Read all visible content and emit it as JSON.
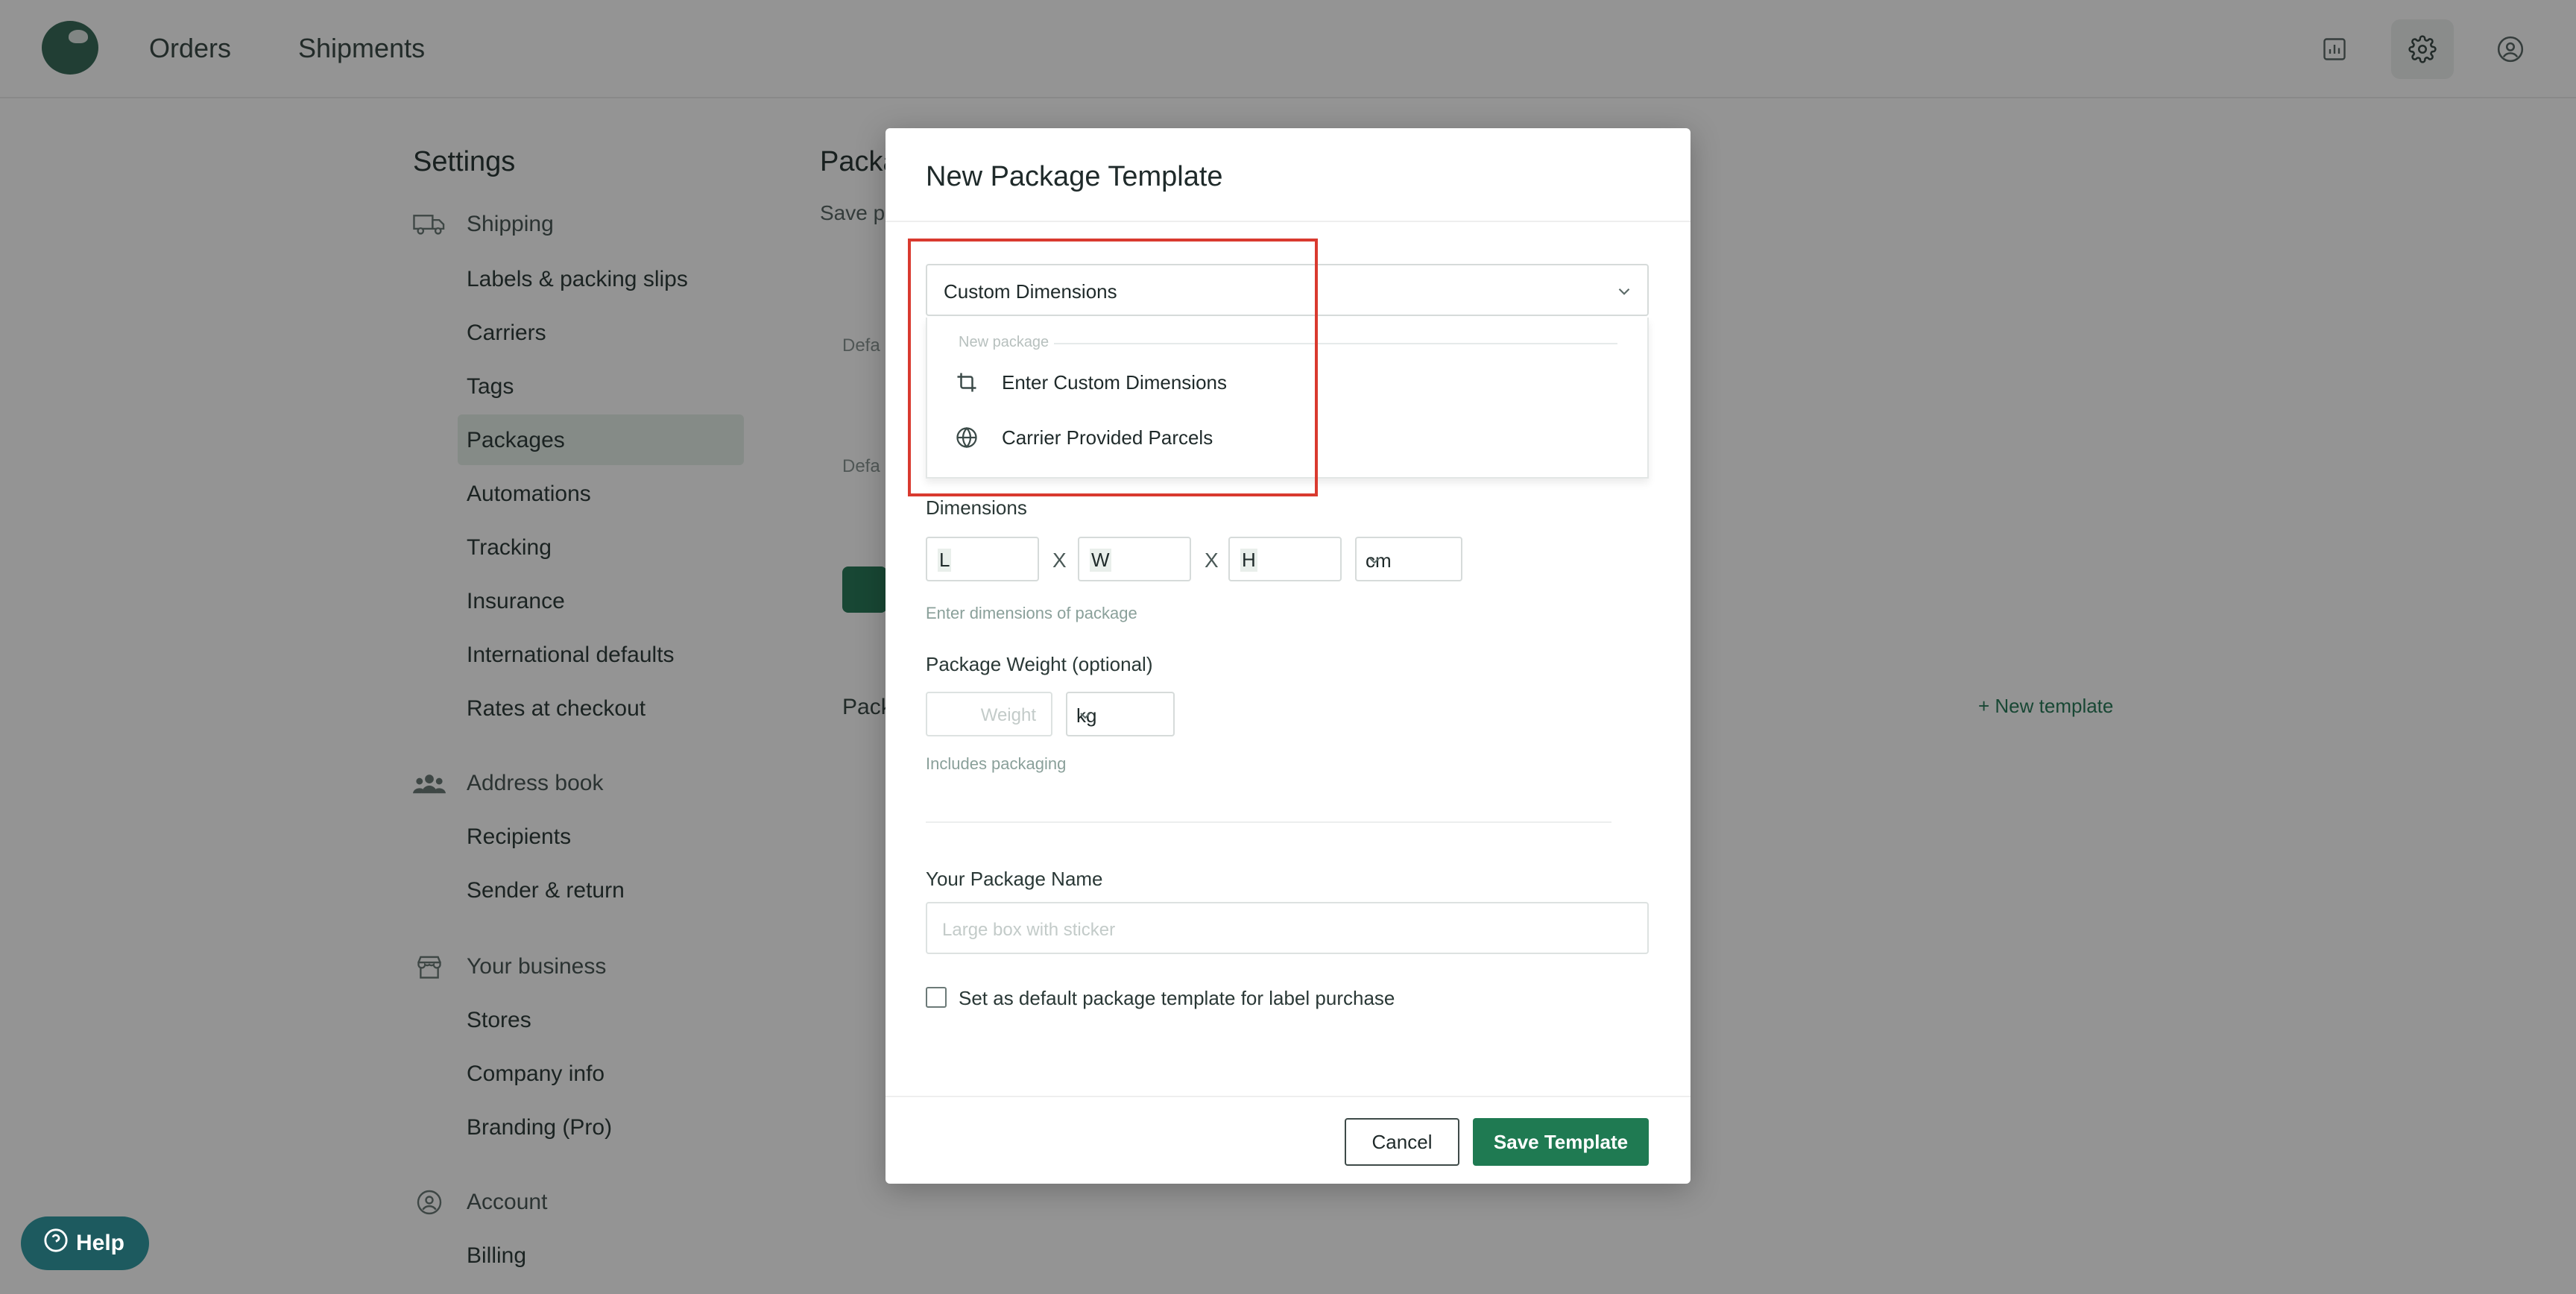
{
  "topbar": {
    "nav": [
      "Orders",
      "Shipments"
    ],
    "icons": [
      "report-icon",
      "gear-icon",
      "user-icon"
    ]
  },
  "settings": {
    "title": "Settings",
    "sections": [
      {
        "label": "Shipping",
        "icon": "truck-icon",
        "items": [
          "Labels & packing slips",
          "Carriers",
          "Tags",
          "Packages",
          "Automations",
          "Tracking",
          "Insurance",
          "International defaults",
          "Rates at checkout"
        ]
      },
      {
        "label": "Address book",
        "icon": "people-icon",
        "items": [
          "Recipients",
          "Sender & return"
        ]
      },
      {
        "label": "Your business",
        "icon": "store-icon",
        "items": [
          "Stores",
          "Company info",
          "Branding (Pro)"
        ]
      },
      {
        "label": "Account",
        "icon": "account-icon",
        "items": [
          "Billing"
        ]
      }
    ],
    "active_item": "Packages"
  },
  "page": {
    "title": "Packa",
    "subtitle": "Save p",
    "label_1": "Defa",
    "label_2": "Defa",
    "packages_label": "Pack",
    "new_template": "+ New template"
  },
  "modal": {
    "title": "New Package Template",
    "package_select": {
      "value": "Custom Dimensions",
      "group_label": "New package",
      "options": [
        {
          "label": "Enter Custom Dimensions",
          "icon": "crop-icon"
        },
        {
          "label": "Carrier Provided Parcels",
          "icon": "globe-icon"
        }
      ]
    },
    "dimensions": {
      "label": "Dimensions",
      "length_placeholder": "L",
      "width_placeholder": "W",
      "height_placeholder": "H",
      "separator": "X",
      "unit": "cm",
      "hint": "Enter dimensions of package"
    },
    "weight": {
      "label": "Package Weight (optional)",
      "placeholder": "Weight",
      "unit": "kg",
      "hint": "Includes packaging"
    },
    "name": {
      "label": "Your Package Name",
      "placeholder": "Large box with sticker"
    },
    "default_checkbox_label": "Set as default package template for label purchase",
    "cancel_label": "Cancel",
    "save_label": "Save Template"
  },
  "help": {
    "label": "Help"
  },
  "colors": {
    "accent": "#1f7a52",
    "highlight": "#d93a2f",
    "help_bg": "#1d5a5f"
  }
}
